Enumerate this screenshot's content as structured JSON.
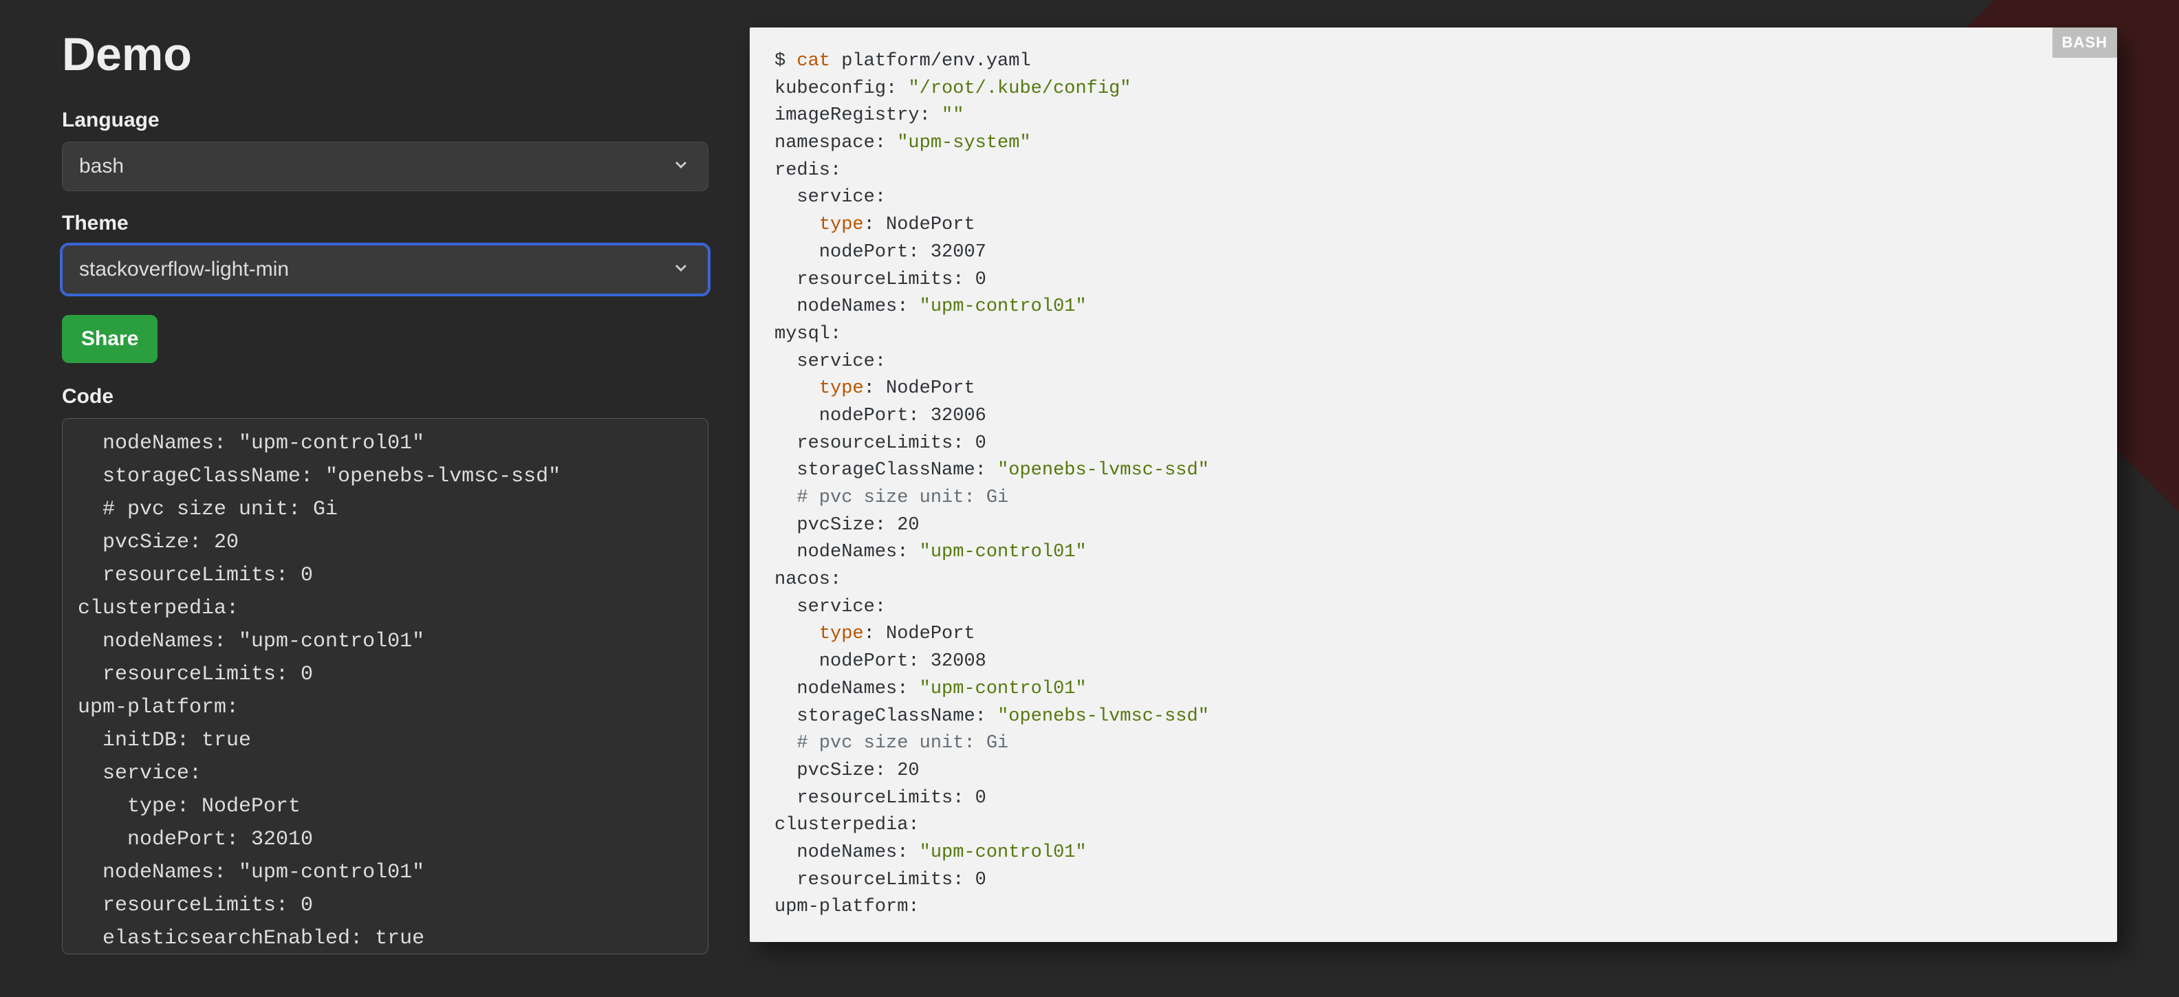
{
  "title": "Demo",
  "labels": {
    "language": "Language",
    "theme": "Theme",
    "code": "Code"
  },
  "language_select": {
    "value": "bash"
  },
  "theme_select": {
    "value": "stackoverflow-light-min"
  },
  "share_button": "Share",
  "code_textarea": "  nodeNames: \"upm-control01\"\n  storageClassName: \"openebs-lvmsc-ssd\"\n  # pvc size unit: Gi\n  pvcSize: 20\n  resourceLimits: 0\nclusterpedia:\n  nodeNames: \"upm-control01\"\n  resourceLimits: 0\nupm-platform:\n  initDB: true\n  service:\n    type: NodePort\n    nodePort: 32010\n  nodeNames: \"upm-control01\"\n  resourceLimits: 0\n  elasticsearchEnabled: true\n  kafkaEnabled: true",
  "preview": {
    "badge": "BASH",
    "tokens": [
      {
        "t": "default",
        "v": "$ "
      },
      {
        "t": "builtin",
        "v": "cat"
      },
      {
        "t": "default",
        "v": " platform/env.yaml\n"
      },
      {
        "t": "default",
        "v": "kubeconfig: "
      },
      {
        "t": "string",
        "v": "\"/root/.kube/config\""
      },
      {
        "t": "default",
        "v": "\n"
      },
      {
        "t": "default",
        "v": "imageRegistry: "
      },
      {
        "t": "string",
        "v": "\"\""
      },
      {
        "t": "default",
        "v": "\n"
      },
      {
        "t": "default",
        "v": "namespace: "
      },
      {
        "t": "string",
        "v": "\"upm-system\""
      },
      {
        "t": "default",
        "v": "\n"
      },
      {
        "t": "default",
        "v": "redis:\n"
      },
      {
        "t": "default",
        "v": "  service:\n"
      },
      {
        "t": "default",
        "v": "    "
      },
      {
        "t": "builtin",
        "v": "type"
      },
      {
        "t": "default",
        "v": ": NodePort\n"
      },
      {
        "t": "default",
        "v": "    nodePort: 32007\n"
      },
      {
        "t": "default",
        "v": "  resourceLimits: 0\n"
      },
      {
        "t": "default",
        "v": "  nodeNames: "
      },
      {
        "t": "string",
        "v": "\"upm-control01\""
      },
      {
        "t": "default",
        "v": "\n"
      },
      {
        "t": "default",
        "v": "mysql:\n"
      },
      {
        "t": "default",
        "v": "  service:\n"
      },
      {
        "t": "default",
        "v": "    "
      },
      {
        "t": "builtin",
        "v": "type"
      },
      {
        "t": "default",
        "v": ": NodePort\n"
      },
      {
        "t": "default",
        "v": "    nodePort: 32006\n"
      },
      {
        "t": "default",
        "v": "  resourceLimits: 0\n"
      },
      {
        "t": "default",
        "v": "  storageClassName: "
      },
      {
        "t": "string",
        "v": "\"openebs-lvmsc-ssd\""
      },
      {
        "t": "default",
        "v": "\n"
      },
      {
        "t": "default",
        "v": "  "
      },
      {
        "t": "comment",
        "v": "# pvc size unit: Gi"
      },
      {
        "t": "default",
        "v": "\n"
      },
      {
        "t": "default",
        "v": "  pvcSize: 20\n"
      },
      {
        "t": "default",
        "v": "  nodeNames: "
      },
      {
        "t": "string",
        "v": "\"upm-control01\""
      },
      {
        "t": "default",
        "v": "\n"
      },
      {
        "t": "default",
        "v": "nacos:\n"
      },
      {
        "t": "default",
        "v": "  service:\n"
      },
      {
        "t": "default",
        "v": "    "
      },
      {
        "t": "builtin",
        "v": "type"
      },
      {
        "t": "default",
        "v": ": NodePort\n"
      },
      {
        "t": "default",
        "v": "    nodePort: 32008\n"
      },
      {
        "t": "default",
        "v": "  nodeNames: "
      },
      {
        "t": "string",
        "v": "\"upm-control01\""
      },
      {
        "t": "default",
        "v": "\n"
      },
      {
        "t": "default",
        "v": "  storageClassName: "
      },
      {
        "t": "string",
        "v": "\"openebs-lvmsc-ssd\""
      },
      {
        "t": "default",
        "v": "\n"
      },
      {
        "t": "default",
        "v": "  "
      },
      {
        "t": "comment",
        "v": "# pvc size unit: Gi"
      },
      {
        "t": "default",
        "v": "\n"
      },
      {
        "t": "default",
        "v": "  pvcSize: 20\n"
      },
      {
        "t": "default",
        "v": "  resourceLimits: 0\n"
      },
      {
        "t": "default",
        "v": "clusterpedia:\n"
      },
      {
        "t": "default",
        "v": "  nodeNames: "
      },
      {
        "t": "string",
        "v": "\"upm-control01\""
      },
      {
        "t": "default",
        "v": "\n"
      },
      {
        "t": "default",
        "v": "  resourceLimits: 0\n"
      },
      {
        "t": "default",
        "v": "upm-platform:\n"
      }
    ]
  }
}
